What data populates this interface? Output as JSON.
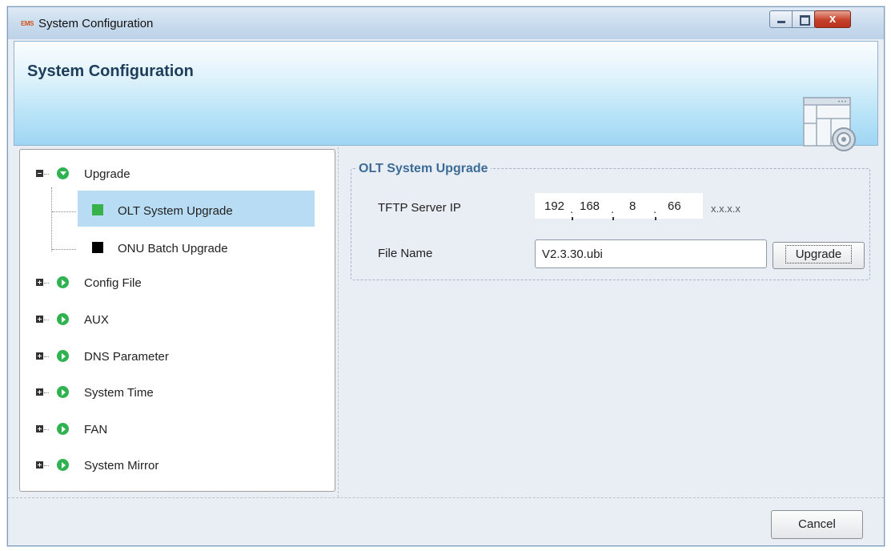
{
  "window": {
    "title": "System Configuration",
    "app_icon_text": "EMS",
    "close_label": "x"
  },
  "banner": {
    "title": "System Configuration",
    "icon": "settings-window-icon"
  },
  "tree": {
    "items": [
      {
        "label": "Upgrade",
        "expanded": true,
        "icon": "green-circle-down-icon",
        "children": [
          {
            "label": "OLT System Upgrade",
            "selected": true,
            "color": "#37b14a"
          },
          {
            "label": "ONU Batch Upgrade",
            "selected": false,
            "color": "#000000"
          }
        ]
      },
      {
        "label": "Config File",
        "expanded": false,
        "icon": "green-circle-right-icon"
      },
      {
        "label": "AUX",
        "expanded": false,
        "icon": "green-circle-right-icon"
      },
      {
        "label": "DNS Parameter",
        "expanded": false,
        "icon": "green-circle-right-icon"
      },
      {
        "label": "System Time",
        "expanded": false,
        "icon": "green-circle-right-icon"
      },
      {
        "label": "FAN",
        "expanded": false,
        "icon": "green-circle-right-icon"
      },
      {
        "label": "System Mirror",
        "expanded": false,
        "icon": "green-circle-right-icon"
      }
    ]
  },
  "upgrade_panel": {
    "group_title": "OLT System Upgrade",
    "tftp_label": "TFTP Server IP",
    "ip": [
      "192",
      "168",
      "8",
      "66"
    ],
    "ip_hint": "x.x.x.x",
    "file_label": "File Name",
    "file_value": "V2.3.30.ubi",
    "upgrade_button": "Upgrade"
  },
  "footer": {
    "cancel_button": "Cancel"
  },
  "colors": {
    "accent": "#3c6b96",
    "selection": "#b7dcf3",
    "status_green": "#2fb24f"
  }
}
